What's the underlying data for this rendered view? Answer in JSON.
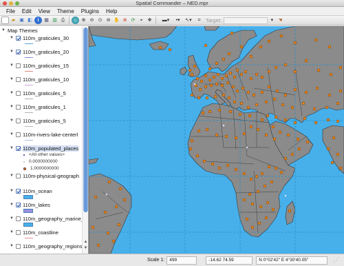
{
  "window": {
    "title": "Spatial Commander – NED.mpr"
  },
  "menubar": {
    "items": [
      "File",
      "Edit",
      "View",
      "Theme",
      "Plugins",
      "Help"
    ]
  },
  "toolbar": {
    "target_label": "Target:"
  },
  "tree": {
    "root_label": "Map Themes",
    "items": [
      {
        "label": "110m_graticules_30",
        "checked": true,
        "swatch": "line",
        "color": "#5aa0d8"
      },
      {
        "label": "110m_graticules_20",
        "checked": true,
        "swatch": "line",
        "color": "#7a8fd0"
      },
      {
        "label": "110m_graticules_15",
        "checked": false,
        "swatch": "line",
        "color": "#e08a7a"
      },
      {
        "label": "110m_graticules_10",
        "checked": false,
        "swatch": "line",
        "color": "#c9a3d8"
      },
      {
        "label": "110m_graticules_5",
        "checked": false,
        "swatch": "line",
        "color": "#aaaaaa"
      },
      {
        "label": "110m_graticules_1",
        "checked": false,
        "swatch": "line",
        "color": "#b0b0b0"
      },
      {
        "label": "110m_graticules_5",
        "checked": false,
        "swatch": "line",
        "color": "#b8b8b8"
      },
      {
        "label": "110m-rivers-lake-centerl",
        "checked": false,
        "swatch": "line",
        "color": "#aac0e0"
      },
      {
        "label": "110m_populated_places",
        "checked": true,
        "swatch": "legend",
        "selected": true
      },
      {
        "label": "110m-physical-geograph",
        "checked": false,
        "swatch": "none"
      },
      {
        "label": "110m_ocean",
        "checked": true,
        "swatch": "box",
        "color": "#47b0ea"
      },
      {
        "label": "110m_lakes",
        "checked": true,
        "swatch": "box",
        "color": "#9a8fe0"
      },
      {
        "label": "110m_geography_marine_",
        "checked": false,
        "swatch": "box",
        "color": "#47b0ea"
      },
      {
        "label": "110m_coastline",
        "checked": false,
        "swatch": "line",
        "color": "#e0909a"
      },
      {
        "label": "110m_geography_regions",
        "checked": false,
        "swatch": "none"
      }
    ],
    "places_legend": [
      "<All other values>",
      "0.0000000000",
      "1.0000000000"
    ]
  },
  "status": {
    "scale_label": "Scale 1:",
    "scale_value": "499",
    "xy": "-14.62   74.59",
    "latlon": "N 0°02'42\"   E 4°30'40.05\""
  },
  "colors": {
    "ocean": "#47b0ea",
    "land": "#8b8b8b",
    "border": "#333333",
    "city": "#f08a1a",
    "graticule": "#2a8fc8"
  }
}
